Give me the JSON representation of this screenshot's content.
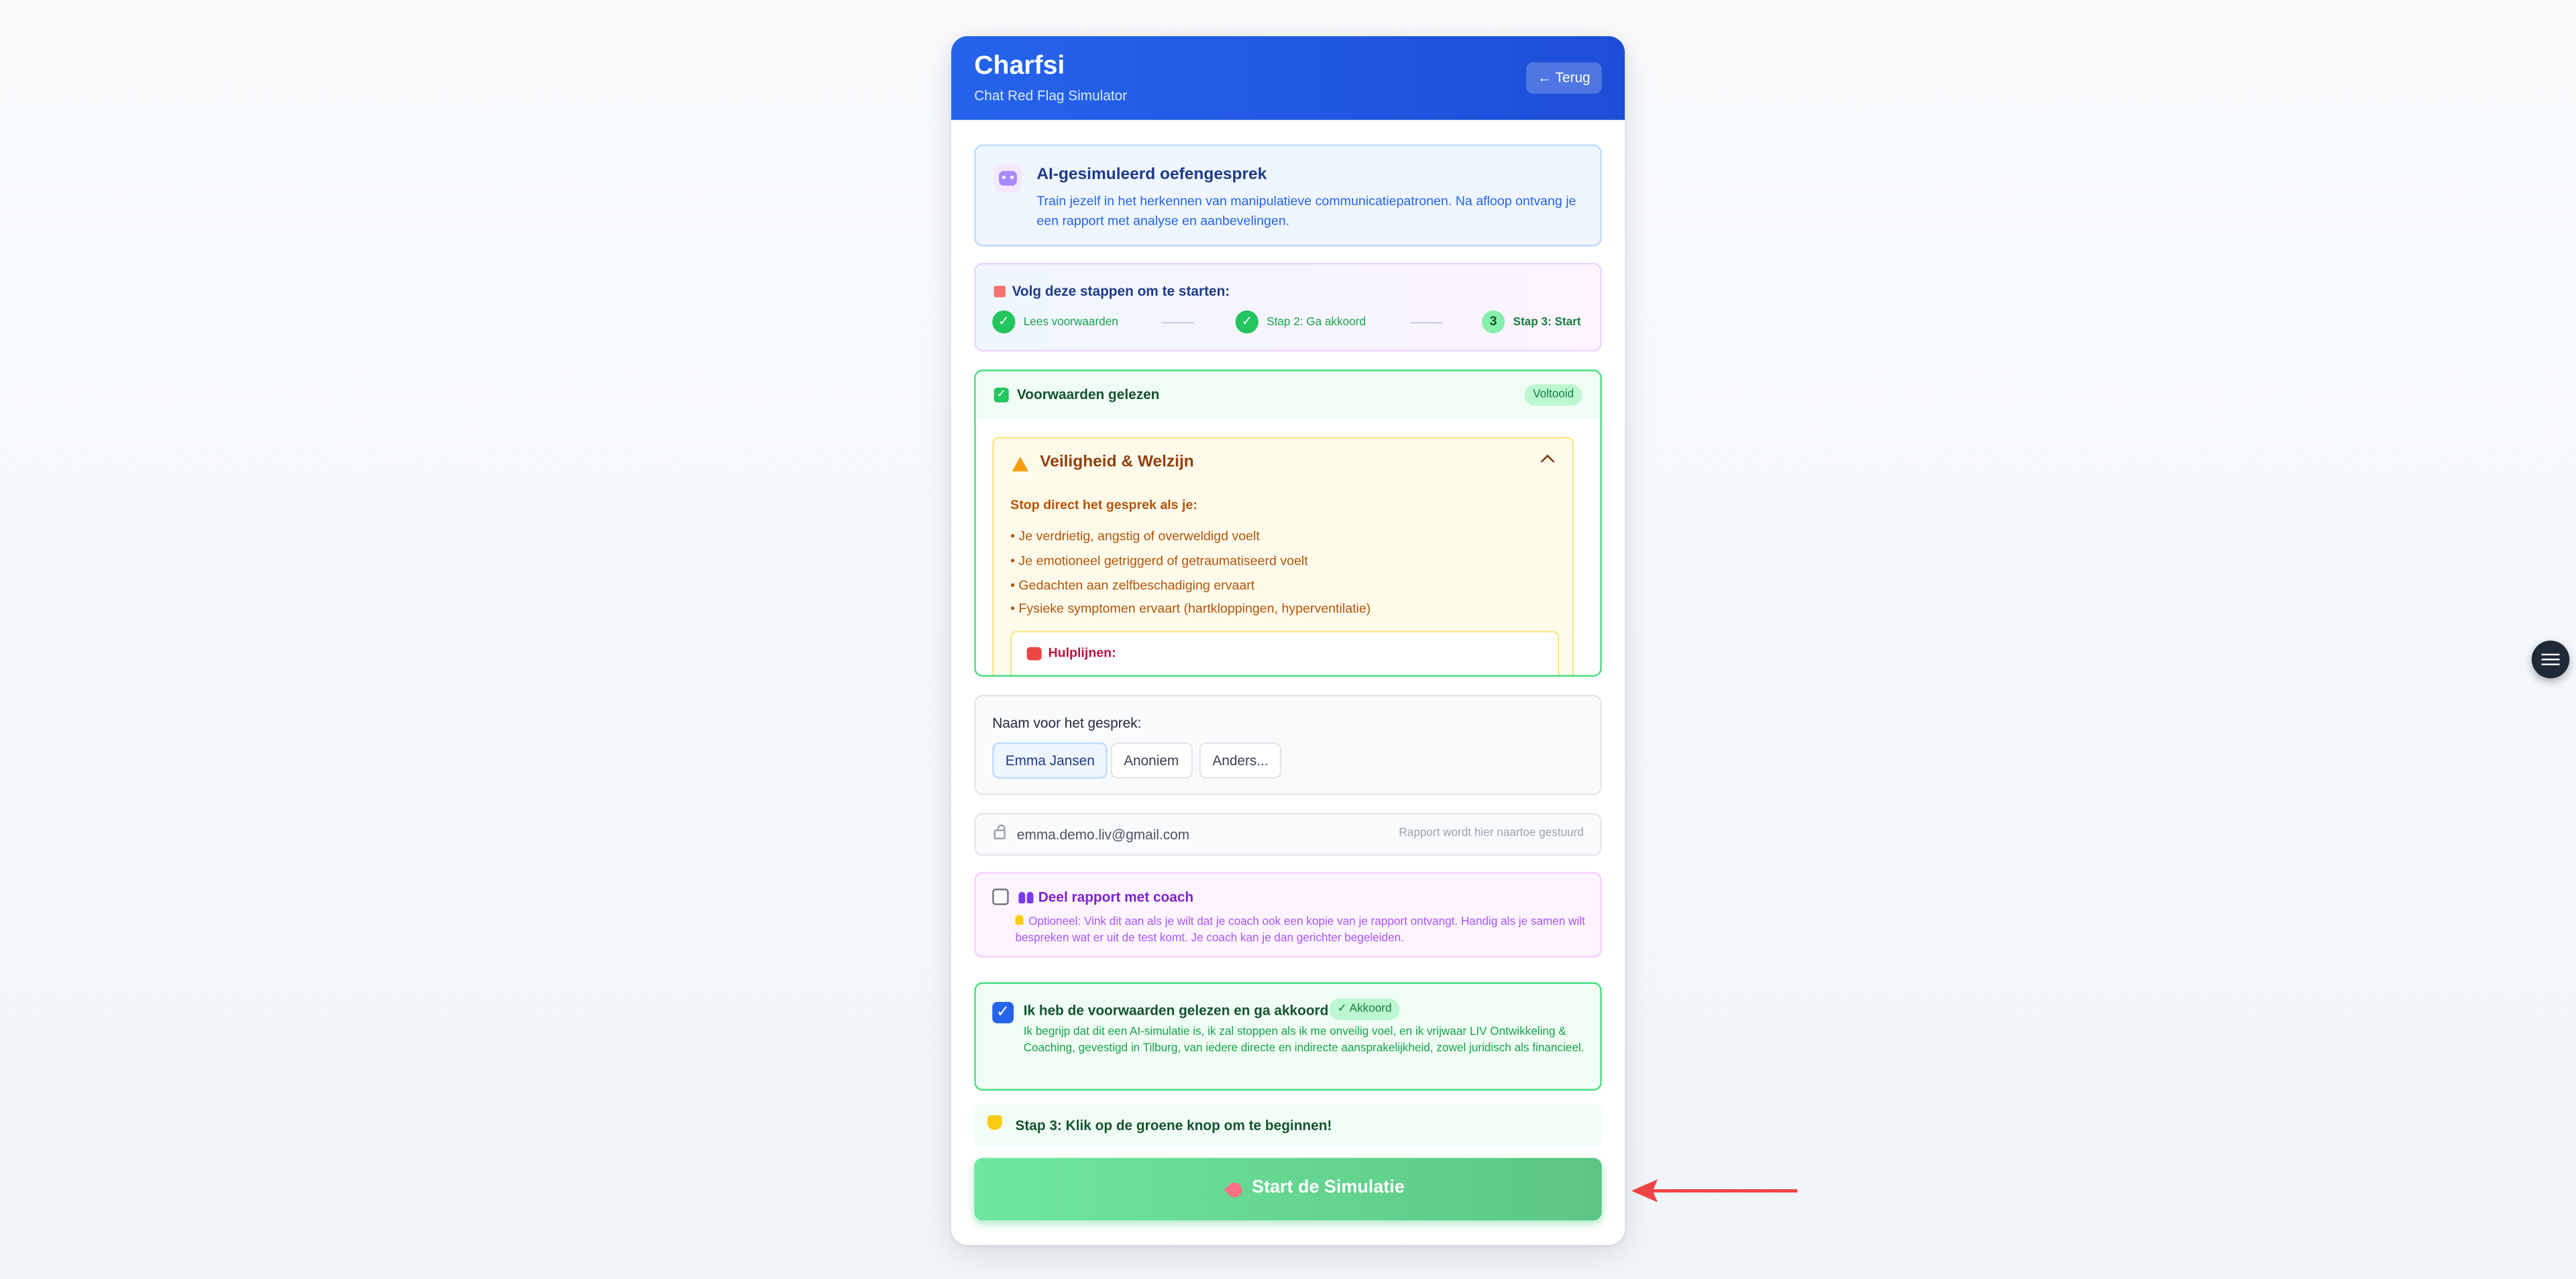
{
  "header": {
    "app_name": "Charfsi",
    "subtitle": "Chat Red Flag Simulator",
    "back_label": "← Terug"
  },
  "intro": {
    "icon": "robot-icon",
    "title": "AI-gesimuleerd oefengesprek",
    "text": "Train jezelf in het herkennen van manipulatieve communicatiepatronen. Na afloop ontvang je een rapport met analyse en aanbevelingen."
  },
  "steps": {
    "title": "Volg deze stappen om te starten:",
    "items": [
      {
        "label": "Lees voorwaarden",
        "state": "done"
      },
      {
        "label": "Stap 2: Ga akkoord",
        "state": "done"
      },
      {
        "label": "Stap 3: Start",
        "state": "current",
        "number": "3"
      }
    ]
  },
  "terms": {
    "title": "Voorwaarden gelezen",
    "badge": "Voltooid",
    "safety": {
      "title": "Veiligheid & Welzijn",
      "stop_title": "Stop direct het gesprek als je:",
      "items": [
        "• Je verdrietig, angstig of overweldigd voelt",
        "• Je emotioneel getriggerd of getraumatiseerd voelt",
        "• Gedachten aan zelfbeschadiging ervaart",
        "• Fysieke symptomen ervaart (hartkloppingen, hyperventilatie)"
      ],
      "helplines_title": "Hulplijnen:"
    }
  },
  "name_section": {
    "label": "Naam voor het gesprek:",
    "options": [
      "Emma Jansen",
      "Anoniem",
      "Anders..."
    ],
    "selected": "Emma Jansen"
  },
  "email": {
    "value": "emma.demo.liv@gmail.com",
    "note": "Rapport wordt hier naartoe gestuurd"
  },
  "coach": {
    "title": "Deel rapport met coach",
    "text": "Optioneel: Vink dit aan als je wilt dat je coach ook een kopie van je rapport ontvangt. Handig als je samen wilt bespreken wat er uit de test komt. Je coach kan je dan gerichter begeleiden.",
    "checked": false
  },
  "agree": {
    "title": "Ik heb de voorwaarden gelezen en ga akkoord",
    "badge": "✓ Akkoord",
    "text": "Ik begrijp dat dit een AI-simulatie is, ik zal stoppen als ik me onveilig voel, en ik vrijwaar LIV Ontwikkeling & Coaching, gevestigd in Tilburg, van iedere directe en indirecte aansprakelijkheid, zowel juridisch als financieel.",
    "checked": true
  },
  "hint": "Stap 3: Klik op de groene knop om te beginnen!",
  "start_button": "Start de Simulatie",
  "colors": {
    "primary": "#2563eb",
    "success": "#22c55e",
    "warning": "#b45309",
    "coach": "#7e22ce"
  }
}
